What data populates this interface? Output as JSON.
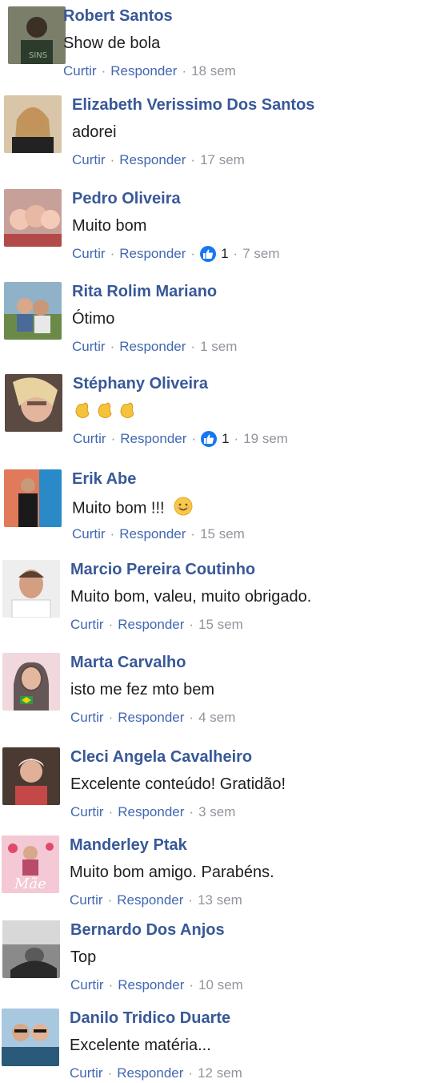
{
  "actions": {
    "like_label": "Curtir",
    "reply_label": "Responder",
    "separator": "·"
  },
  "comments": [
    {
      "name": "Robert Santos",
      "text": "Show de bola",
      "time": "18 sem",
      "reactions": null
    },
    {
      "name": "Elizabeth Verissimo Dos Santos",
      "text": "adorei",
      "time": "17 sem",
      "reactions": null
    },
    {
      "name": "Pedro Oliveira",
      "text": "Muito bom",
      "time": "7 sem",
      "reactions": "1"
    },
    {
      "name": "Rita Rolim Mariano",
      "text": "Ótimo",
      "time": "1 sem",
      "reactions": null
    },
    {
      "name": "Stéphany Oliveira",
      "text": "",
      "emoji": "clapping-hands-emoji",
      "time": "19 sem",
      "reactions": "1"
    },
    {
      "name": "Erik Abe",
      "text": "Muito bom !!!",
      "emoji": "smiling-face-emoji",
      "time": "15 sem",
      "reactions": null
    },
    {
      "name": "Marcio Pereira Coutinho",
      "text": "Muito bom, valeu, muito obrigado.",
      "time": "15 sem",
      "reactions": null
    },
    {
      "name": "Marta Carvalho",
      "text": "isto me fez mto bem",
      "time": "4 sem",
      "reactions": null
    },
    {
      "name": "Cleci Angela Cavalheiro",
      "text": "Excelente conteúdo! Gratidão!",
      "time": "3 sem",
      "reactions": null
    },
    {
      "name": "Manderley Ptak",
      "text": "Muito bom amigo. Parabéns.",
      "time": "13 sem",
      "reactions": null
    },
    {
      "name": "Bernardo Dos Anjos",
      "text": "Top",
      "time": "10 sem",
      "reactions": null
    },
    {
      "name": "Danilo Tridico Duarte",
      "text": "Excelente matéria...",
      "time": "12 sem",
      "reactions": null
    }
  ],
  "colors": {
    "name": "#385898",
    "link": "#4267b2",
    "meta": "#90949c",
    "text": "#1c1e21",
    "like": "#1877f2"
  },
  "icons": {
    "like": "thumbs-up-icon"
  }
}
